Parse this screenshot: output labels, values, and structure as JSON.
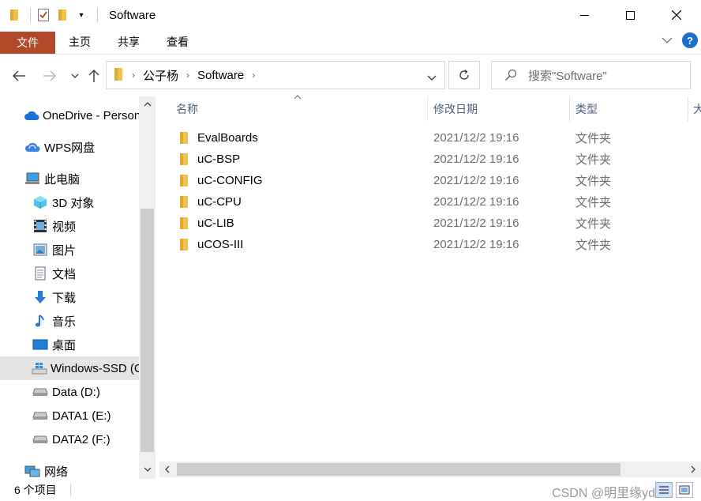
{
  "window": {
    "title": "Software",
    "controls": {
      "minimize": "–",
      "maximize": "☐",
      "close": "✕"
    }
  },
  "ribbon": {
    "tabs": [
      "文件",
      "主页",
      "共享",
      "查看"
    ],
    "help_label": "?"
  },
  "nav": {
    "breadcrumb": [
      "公子杨",
      "Software"
    ],
    "search_placeholder": "搜索\"Software\""
  },
  "sidebar": {
    "items": [
      {
        "label": "OneDrive - Personal",
        "icon": "cloud-icon"
      },
      {
        "label": "WPS网盘",
        "icon": "wps-cloud-icon"
      },
      {
        "label": "此电脑",
        "icon": "computer-icon"
      },
      {
        "label": "3D 对象",
        "icon": "cube-3d-icon"
      },
      {
        "label": "视频",
        "icon": "video-icon"
      },
      {
        "label": "图片",
        "icon": "picture-icon"
      },
      {
        "label": "文档",
        "icon": "document-icon"
      },
      {
        "label": "下载",
        "icon": "download-icon"
      },
      {
        "label": "音乐",
        "icon": "music-icon"
      },
      {
        "label": "桌面",
        "icon": "desktop-icon"
      },
      {
        "label": "Windows-SSD (C:)",
        "icon": "windows-drive-icon",
        "selected": true
      },
      {
        "label": "Data (D:)",
        "icon": "drive-icon"
      },
      {
        "label": "DATA1 (E:)",
        "icon": "drive-icon"
      },
      {
        "label": "DATA2 (F:)",
        "icon": "drive-icon"
      },
      {
        "label": "网络",
        "icon": "network-icon"
      }
    ]
  },
  "content": {
    "columns": [
      "名称",
      "修改日期",
      "类型",
      "大小"
    ],
    "rows": [
      {
        "name": "EvalBoards",
        "date": "2021/12/2 19:16",
        "type": "文件夹"
      },
      {
        "name": "uC-BSP",
        "date": "2021/12/2 19:16",
        "type": "文件夹"
      },
      {
        "name": "uC-CONFIG",
        "date": "2021/12/2 19:16",
        "type": "文件夹"
      },
      {
        "name": "uC-CPU",
        "date": "2021/12/2 19:16",
        "type": "文件夹"
      },
      {
        "name": "uC-LIB",
        "date": "2021/12/2 19:16",
        "type": "文件夹"
      },
      {
        "name": "uCOS-III",
        "date": "2021/12/2 19:16",
        "type": "文件夹"
      }
    ]
  },
  "status": {
    "count": "6 个项目",
    "watermark": "CSDN @明里缘yds"
  },
  "colors": {
    "file_tab": "#b04a2a",
    "folder": "#f0c24b",
    "header_text": "#4c607a",
    "selection": "#e5e5e5"
  }
}
